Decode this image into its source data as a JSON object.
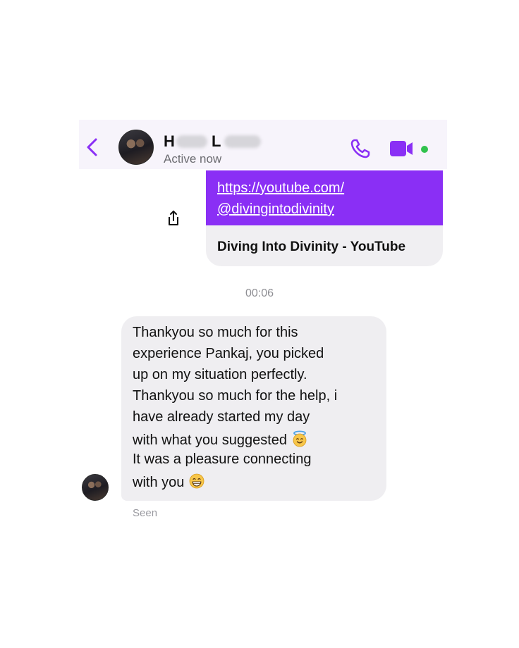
{
  "header": {
    "name_initial": "H",
    "name_second_initial": "L",
    "presence": "Active now",
    "back_icon": "chevron-left-icon",
    "call_icon": "phone-icon",
    "video_icon": "video-camera-icon"
  },
  "shared_link": {
    "url_line1": "https://youtube.com/",
    "url_line2": "@divingintodivinity",
    "title": "Diving Into Divinity - YouTube",
    "share_icon": "share-icon"
  },
  "timestamp": "00:06",
  "incoming_message": {
    "lines": [
      "Thankyou so much for this",
      "experience Pankaj, you picked",
      "up on my situation perfectly.",
      "Thankyou so much for the help, i",
      "have already started my day",
      "with what you suggested",
      "It was a pleasure connecting",
      "with you"
    ],
    "emoji_1": "smiling-face-with-halo-emoji",
    "emoji_2": "grinning-face-emoji"
  },
  "status": "Seen",
  "colors": {
    "accent": "#8a2ff5",
    "online": "#31c24d",
    "bubble": "#efeef1",
    "header_bg": "#f7f4fb"
  }
}
